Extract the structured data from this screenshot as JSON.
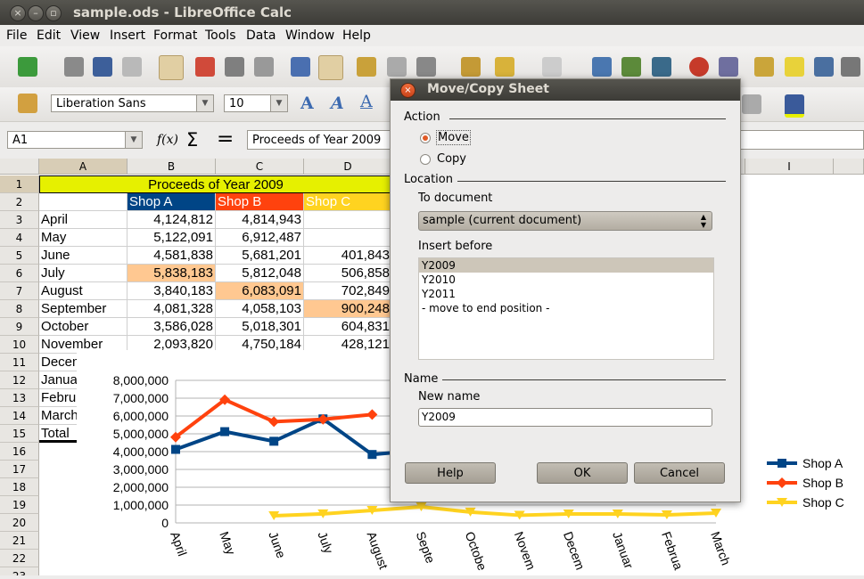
{
  "window": {
    "title": "sample.ods - LibreOffice Calc"
  },
  "menu": [
    "File",
    "Edit",
    "View",
    "Insert",
    "Format",
    "Tools",
    "Data",
    "Window",
    "Help"
  ],
  "formatting": {
    "font_name": "Liberation Sans",
    "font_size": "10"
  },
  "formula_bar": {
    "cell_ref": "A1",
    "content": "Proceeds of Year 2009"
  },
  "columns": [
    "A",
    "B",
    "C",
    "D",
    "I"
  ],
  "rows": [
    "1",
    "2",
    "3",
    "4",
    "5",
    "6",
    "7",
    "8",
    "9",
    "10",
    "11",
    "12",
    "13",
    "14",
    "15",
    "16",
    "17",
    "18",
    "19",
    "20",
    "21",
    "22",
    "23"
  ],
  "sheet": {
    "title": "Proceeds of Year 2009",
    "headers": [
      "Shop A",
      "Shop B",
      "Shop C"
    ],
    "data": [
      [
        "April",
        "4,124,812",
        "4,814,943",
        ""
      ],
      [
        "May",
        "5,122,091",
        "6,912,487",
        ""
      ],
      [
        "June",
        "4,581,838",
        "5,681,201",
        "401,843"
      ],
      [
        "July",
        "5,838,183",
        "5,812,048",
        "506,858"
      ],
      [
        "August",
        "3,840,183",
        "6,083,091",
        "702,849"
      ],
      [
        "September",
        "4,081,328",
        "4,058,103",
        "900,248"
      ],
      [
        "October",
        "3,586,028",
        "5,018,301",
        "604,831"
      ],
      [
        "November",
        "2,093,820",
        "4,750,184",
        "428,121"
      ],
      [
        "Decem",
        "",
        "",
        ""
      ],
      [
        "Janua",
        "",
        "",
        ""
      ],
      [
        "Febru",
        "",
        "",
        ""
      ],
      [
        "March",
        "",
        "",
        ""
      ],
      [
        "Total",
        "",
        "",
        ""
      ]
    ],
    "colors": {
      "title_bg": "#e6f000",
      "shop_a": "#004586",
      "shop_b": "#ff420e",
      "shop_c": "#ffd320",
      "highlight": "#ffc891"
    }
  },
  "chart_data": {
    "type": "line",
    "categories": [
      "April",
      "May",
      "June",
      "July",
      "August",
      "September",
      "October",
      "November",
      "December",
      "January",
      "February",
      "March"
    ],
    "series": [
      {
        "name": "Shop A",
        "color": "#004586",
        "values": [
          4124812,
          5122091,
          4581838,
          5838183,
          3840183,
          4081328,
          null,
          null,
          null,
          null,
          null,
          null
        ]
      },
      {
        "name": "Shop B",
        "color": "#ff420e",
        "values": [
          4814943,
          6912487,
          5681201,
          5812048,
          6083091,
          null,
          null,
          null,
          null,
          null,
          null,
          null
        ]
      },
      {
        "name": "Shop C",
        "color": "#ffd320",
        "values": [
          null,
          null,
          401843,
          506858,
          702849,
          900248,
          604831,
          428121,
          500000,
          500000,
          450000,
          550000
        ]
      }
    ],
    "ylim": [
      0,
      8000000
    ],
    "yticks": [
      "8,000,000",
      "7,000,000",
      "6,000,000",
      "5,000,000",
      "4,000,000",
      "3,000,000",
      "2,000,000",
      "1,000,000",
      "0"
    ],
    "xticks": [
      "April",
      "May",
      "June",
      "July",
      "August",
      "Septe",
      "Octobe",
      "Novem",
      "Decem",
      "Januar",
      "Februa",
      "March"
    ],
    "legend_position": "right",
    "grid": true
  },
  "dialog": {
    "title": "Move/Copy Sheet",
    "action_label": "Action",
    "move_label": "Move",
    "copy_label": "Copy",
    "location_label": "Location",
    "to_document_label": "To document",
    "to_document_value": "sample (current document)",
    "insert_before_label": "Insert before",
    "insert_before_items": [
      "Y2009",
      "Y2010",
      "Y2011",
      "- move to end position -"
    ],
    "name_label": "Name",
    "new_name_label": "New name",
    "new_name_value": "Y2009",
    "help_button": "Help",
    "ok_button": "OK",
    "cancel_button": "Cancel"
  }
}
